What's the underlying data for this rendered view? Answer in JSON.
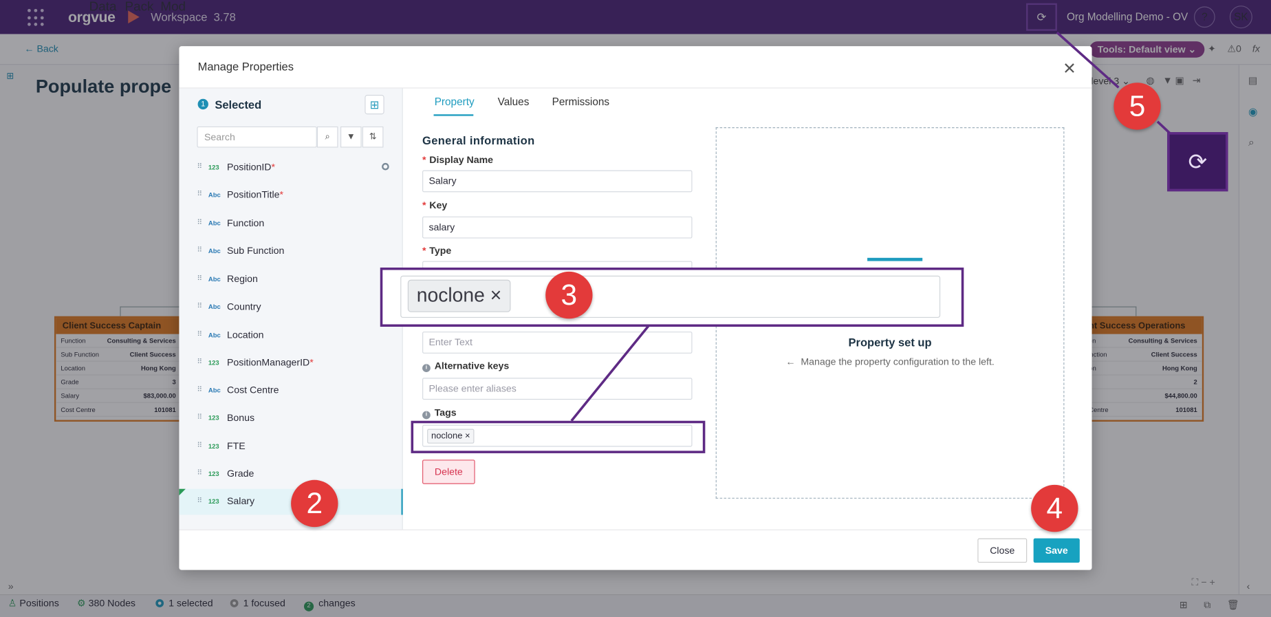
{
  "app": {
    "logo": "orgvue",
    "workspace": "Workspace",
    "version": "3.78",
    "demo_title": "Org Modelling Demo - OV",
    "help": "?",
    "avatar": "SK"
  },
  "subbar": {
    "back": "Back",
    "menu": [
      "Data",
      "Pack",
      "Mod"
    ],
    "tools": "Tools: Default view",
    "alerts": "0",
    "level": "level 3"
  },
  "canvas": {
    "title": "Populate prope",
    "card_left": {
      "title": "Client Success Captain",
      "rows": [
        {
          "k": "Function",
          "v": "Consulting & Services"
        },
        {
          "k": "Sub Function",
          "v": "Client Success"
        },
        {
          "k": "Location",
          "v": "Hong Kong"
        },
        {
          "k": "Grade",
          "v": "3"
        },
        {
          "k": "Salary",
          "v": "$83,000.00"
        },
        {
          "k": "Cost Centre",
          "v": "101081"
        }
      ]
    },
    "card_right": {
      "title": "ent Success Operations",
      "rows": [
        {
          "k": "ction",
          "v": "Consulting & Services"
        },
        {
          "k": "Function",
          "v": "Client Success"
        },
        {
          "k": "ation",
          "v": "Hong Kong"
        },
        {
          "k": "de",
          "v": "2"
        },
        {
          "k": "ry",
          "v": "$44,800.00"
        },
        {
          "k": "st Centre",
          "v": "101081"
        }
      ]
    }
  },
  "status": {
    "positions": "Positions",
    "nodes": "380 Nodes",
    "selected": "1 selected",
    "focused": "1 focused",
    "changes_count": "2",
    "changes": "changes"
  },
  "modal": {
    "title": "Manage Properties",
    "selected_count": "1",
    "selected_label": "Selected",
    "search_placeholder": "Search",
    "properties": [
      {
        "type": "123",
        "name": "PositionID",
        "required": "*"
      },
      {
        "type": "Abc",
        "name": "PositionTitle",
        "required": "*"
      },
      {
        "type": "Abc",
        "name": "Function",
        "required": ""
      },
      {
        "type": "Abc",
        "name": "Sub Function",
        "required": ""
      },
      {
        "type": "Abc",
        "name": "Region",
        "required": ""
      },
      {
        "type": "Abc",
        "name": "Country",
        "required": ""
      },
      {
        "type": "Abc",
        "name": "Location",
        "required": ""
      },
      {
        "type": "123",
        "name": "PositionManagerID",
        "required": "*"
      },
      {
        "type": "Abc",
        "name": "Cost Centre",
        "required": ""
      },
      {
        "type": "123",
        "name": "Bonus",
        "required": ""
      },
      {
        "type": "123",
        "name": "FTE",
        "required": ""
      },
      {
        "type": "123",
        "name": "Grade",
        "required": ""
      },
      {
        "type": "123",
        "name": "Salary",
        "required": ""
      }
    ],
    "tabs": [
      "Property",
      "Values",
      "Permissions"
    ],
    "section": "General information",
    "display_name_label": "Display Name",
    "display_name_value": "Salary",
    "key_label": "Key",
    "key_value": "salary",
    "type_label": "Type",
    "description_placeholder": "Enter Text",
    "alt_keys_label": "Alternative keys",
    "alt_keys_placeholder": "Please enter aliases",
    "tags_label": "Tags",
    "tag": "noclone",
    "delete": "Delete",
    "preview_title": "Property set up",
    "preview_sub": "Manage the property configuration to the left.",
    "close": "Close",
    "save": "Save"
  },
  "callouts": {
    "zoom_tag": "noclone",
    "steps": [
      "2",
      "3",
      "4",
      "5"
    ]
  },
  "colors": {
    "brand": "#4b2377",
    "accent": "#17a2c0",
    "callout": "#e33a3a",
    "highlight": "#5e2a84"
  }
}
